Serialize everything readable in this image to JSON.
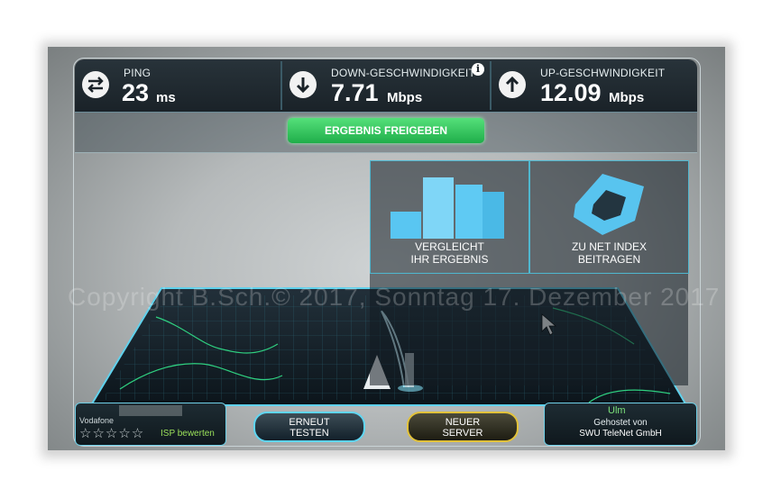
{
  "stats": {
    "ping": {
      "label": "PING",
      "value": "23",
      "unit": "ms",
      "icon": "exchange-arrows-icon"
    },
    "download": {
      "label": "DOWN-GESCHWINDIGKEIT",
      "value": "7.71",
      "unit": "Mbps",
      "icon": "arrow-down-icon",
      "info": "i"
    },
    "upload": {
      "label": "UP-GESCHWINDIGKEIT",
      "value": "12.09",
      "unit": "Mbps",
      "icon": "arrow-up-icon"
    }
  },
  "share_button": "ERGEBNIS FREIGEBEN",
  "tiles": {
    "compare": {
      "line1": "VERGLEICHT",
      "line2": "IHR ERGEBNIS"
    },
    "contribute": {
      "line1": "ZU NET INDEX",
      "line2": "BEITRAGEN"
    }
  },
  "watermark": "Copyright B.Sch.© 2017, Sonntag 17. Dezember 2017",
  "isp": {
    "name": "Vodafone",
    "rating_label": "ISP bewerten",
    "stars": 0
  },
  "buttons": {
    "retest": {
      "line1": "ERNEUT",
      "line2": "TESTEN"
    },
    "new_server": {
      "line1": "NEUER",
      "line2": "SERVER"
    }
  },
  "server": {
    "city": "Ulm",
    "host_line1": "Gehostet von",
    "host_line2": "SWU TeleNet GmbH"
  },
  "colors": {
    "accent_green": "#1fae4a",
    "accent_cyan": "#4fd7f0",
    "server_gold": "#d9b21f"
  }
}
